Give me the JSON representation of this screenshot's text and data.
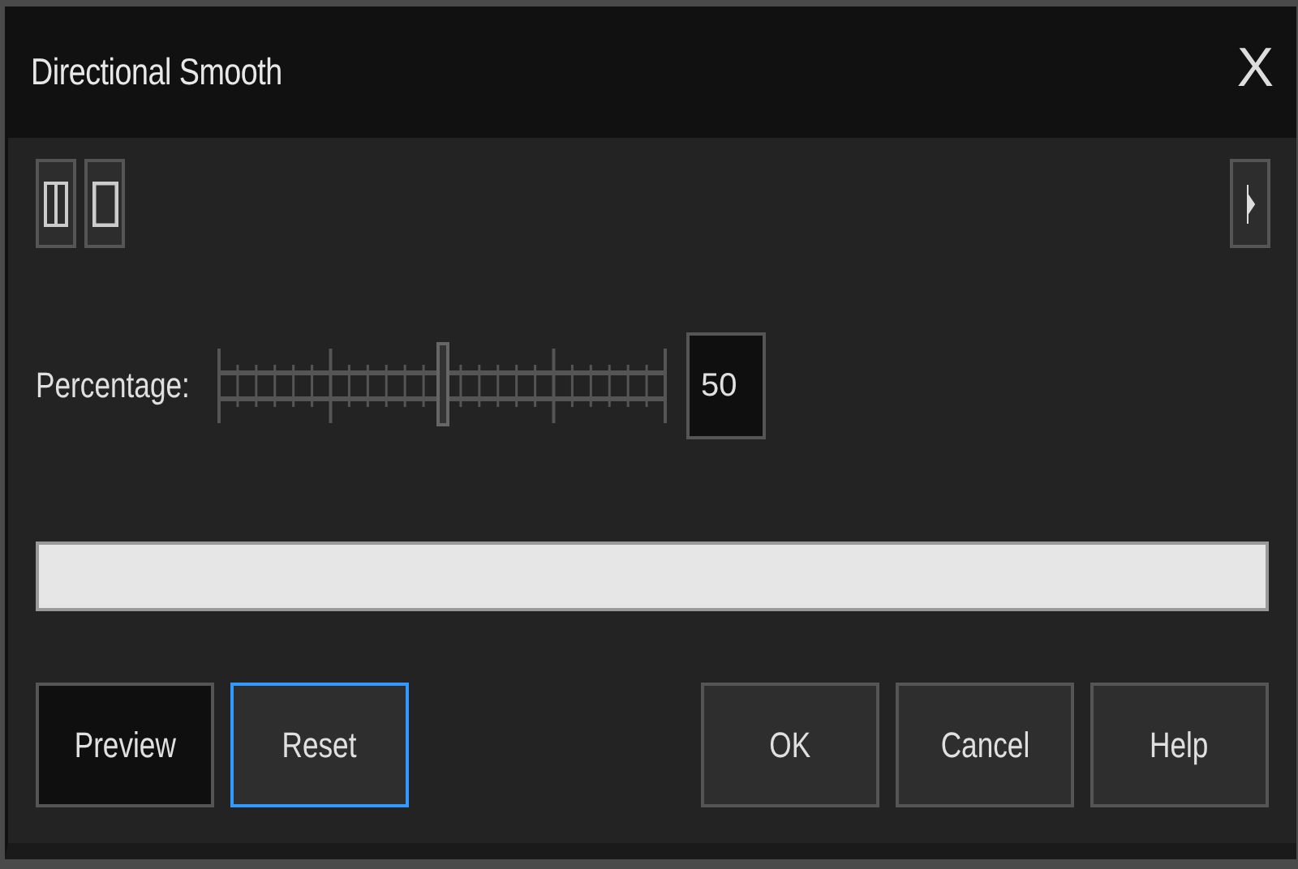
{
  "window": {
    "title": "Directional Smooth",
    "close": "X"
  },
  "toolbar": {
    "left_buttons": [
      {
        "kind": "split"
      },
      {
        "kind": "single"
      }
    ],
    "right_button": {
      "kind": "arrow"
    }
  },
  "slider": {
    "label": "Percentage:",
    "level": 0.5,
    "value": "50"
  },
  "progress": {
    "level": 0
  },
  "buttons": [
    {
      "label": "Preview",
      "focused": false,
      "kind": "dark"
    },
    {
      "label": "Reset",
      "focused": true,
      "kind": "normal"
    },
    {
      "label": "OK",
      "focused": false,
      "kind": "normal"
    },
    {
      "label": "Cancel",
      "focused": false,
      "kind": "normal"
    },
    {
      "label": "Help",
      "focused": false,
      "kind": "normal"
    }
  ]
}
